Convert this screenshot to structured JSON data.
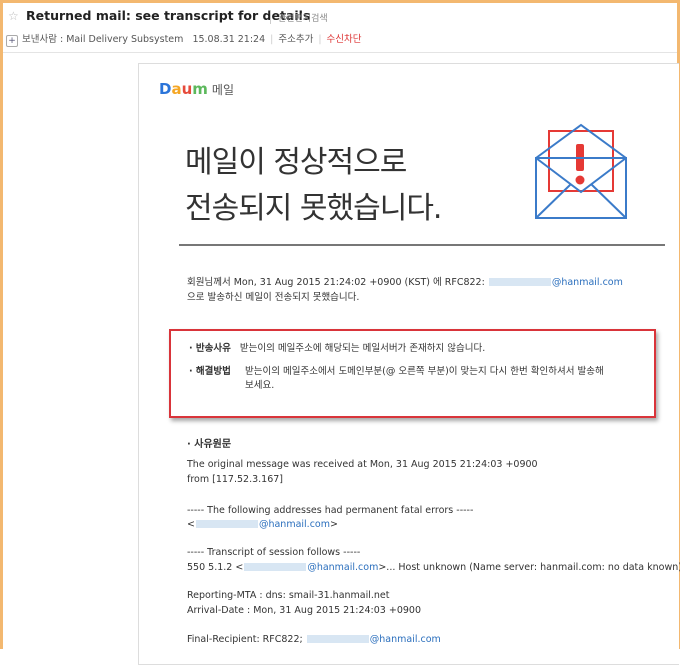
{
  "header": {
    "subject": "Returned mail: see transcript for details",
    "related_search": "관련편지검색",
    "sender_label": "보낸사람 : Mail Delivery Subsystem",
    "date": "15.08.31 21:24",
    "add_address": "주소추가",
    "block_receive": "수신차단"
  },
  "content": {
    "logo": {
      "d": "D",
      "a": "a",
      "u": "u",
      "m": "m",
      "mail": "메일"
    },
    "title_line1": "메일이 정상적으로",
    "title_line2": "전송되지 못했습니다.",
    "intro_prefix": "회원님께서 Mon, 31 Aug 2015 21:24:02 +0900 (KST) 에 RFC822:",
    "intro_email": "@hanmail.com",
    "intro_line2": "으로 발송하신 메일이 전송되지 못했습니다.",
    "reason_label": "· 반송사유",
    "reason_text": "받는이의 메일주소에 해당되는 메일서버가 존재하지 않습니다.",
    "solution_label": "· 해결방법",
    "solution_text1": "받는이의 메일주소에서 도메인부분(@ 오른쪽 부분)이 맞는지 다시 한번 확인하셔서 발송해",
    "solution_text2": "보세요.",
    "section_title": "· 사유원문",
    "transcript": {
      "l1": "The original message was received at Mon, 31 Aug 2015 21:24:03 +0900",
      "l2": "from [117.52.3.167]",
      "l3": "----- The following addresses had permanent fatal errors -----",
      "l4_pre": "<",
      "l4_email": "@hanmail.com",
      "l4_post": ">",
      "l5": "----- Transcript of session follows -----",
      "l6_pre": "550 5.1.2 <",
      "l6_email": "@hanmail.com",
      "l6_post": ">... Host unknown (Name server: hanmail.com: no data known)",
      "l7": "Reporting-MTA : dns: smail-31.hanmail.net",
      "l8": "Arrival-Date : Mon, 31 Aug 2015 21:24:03 +0900",
      "l9_pre": "Final-Recipient: RFC822;",
      "l9_email": "@hanmail.com"
    }
  },
  "colors": {
    "frame": "#f3b870",
    "red_box": "#d9343a",
    "link": "#2b6fbd",
    "envelope": "#3b7bc9",
    "alert": "#e53935"
  }
}
